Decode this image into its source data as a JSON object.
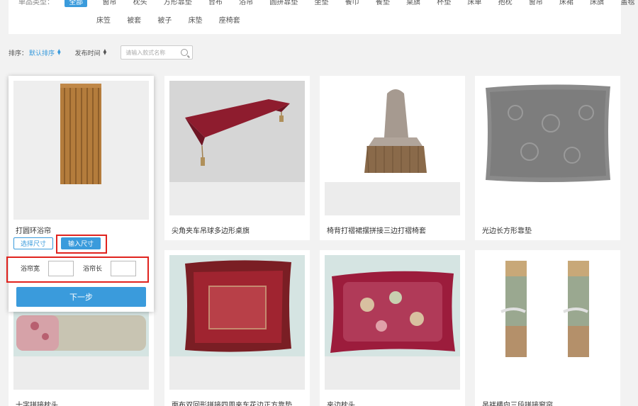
{
  "filter": {
    "label": "单品类型：",
    "row1": [
      "全部",
      "窗帘",
      "枕头",
      "方形靠垫",
      "台布",
      "浴帘",
      "圆拼靠垫",
      "坐垫",
      "餐巾",
      "餐垫",
      "桌旗",
      "杯垫",
      "床单",
      "抱枕",
      "窗帘",
      "床裙",
      "床旗",
      "盖毯"
    ],
    "row2": [
      "床笠",
      "被套",
      "被子",
      "床垫",
      "座椅套"
    ]
  },
  "sort": {
    "label": "排序：",
    "default": "默认排序",
    "time": "发布时间",
    "search_placeholder": "请输入款式名称"
  },
  "popup": {
    "title": "打圆环浴帘",
    "select_size": "选择尺寸",
    "input_size": "输入尺寸",
    "width_label": "浴帘宽",
    "length_label": "浴帘长",
    "next": "下一步"
  },
  "products": [
    {
      "title": "尖角夹车吊球多边形桌旗"
    },
    {
      "title": "椅背打褶裙摆拼接三边打褶椅套"
    },
    {
      "title": "光边长方形靠垫"
    },
    {
      "title": "十字拼接枕头"
    },
    {
      "title": "面布双回形拼接四周夹车花边正方靠垫"
    },
    {
      "title": "夹边枕头"
    },
    {
      "title": "吊袢横向三段拼接窗帘"
    }
  ]
}
